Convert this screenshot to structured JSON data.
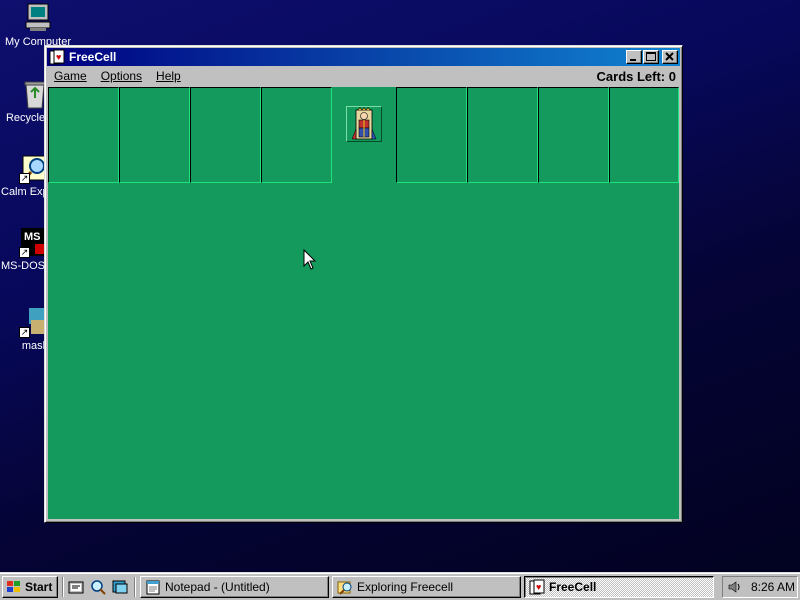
{
  "desktop": {
    "icons": [
      {
        "label": "My Computer",
        "icon": "my-computer-icon"
      },
      {
        "label": "Recycle Bin",
        "icon": "recycle-bin-icon"
      },
      {
        "label": "Calm Explorer",
        "icon": "calm-explorer-icon"
      },
      {
        "label": "MS-DOS Prompt",
        "icon": "ms-dos-icon"
      },
      {
        "label": "mask",
        "icon": "mask-icon"
      }
    ]
  },
  "window": {
    "title": "FreeCell",
    "menu": {
      "game": "Game",
      "options": "Options",
      "help": "Help"
    },
    "cards_left_label": "Cards Left:",
    "cards_left_value": "0",
    "free_cells": 4,
    "home_cells": 4,
    "center_icon": "king-icon"
  },
  "taskbar": {
    "start_label": "Start",
    "quick_launch": [
      "browser-icon",
      "explorer-icon",
      "channels-icon"
    ],
    "tasks": [
      {
        "label": "Notepad - (Untitled)",
        "icon": "notepad-icon",
        "active": false
      },
      {
        "label": "Exploring Freecell",
        "icon": "explorer-folder-icon",
        "active": false
      },
      {
        "label": "FreeCell",
        "icon": "freecell-icon",
        "active": true
      }
    ],
    "clock": "8:26 AM"
  },
  "colors": {
    "felt": "#149a5c",
    "titlebar_start": "#000080",
    "titlebar_end": "#1084d0",
    "chrome": "#c0c0c0"
  }
}
